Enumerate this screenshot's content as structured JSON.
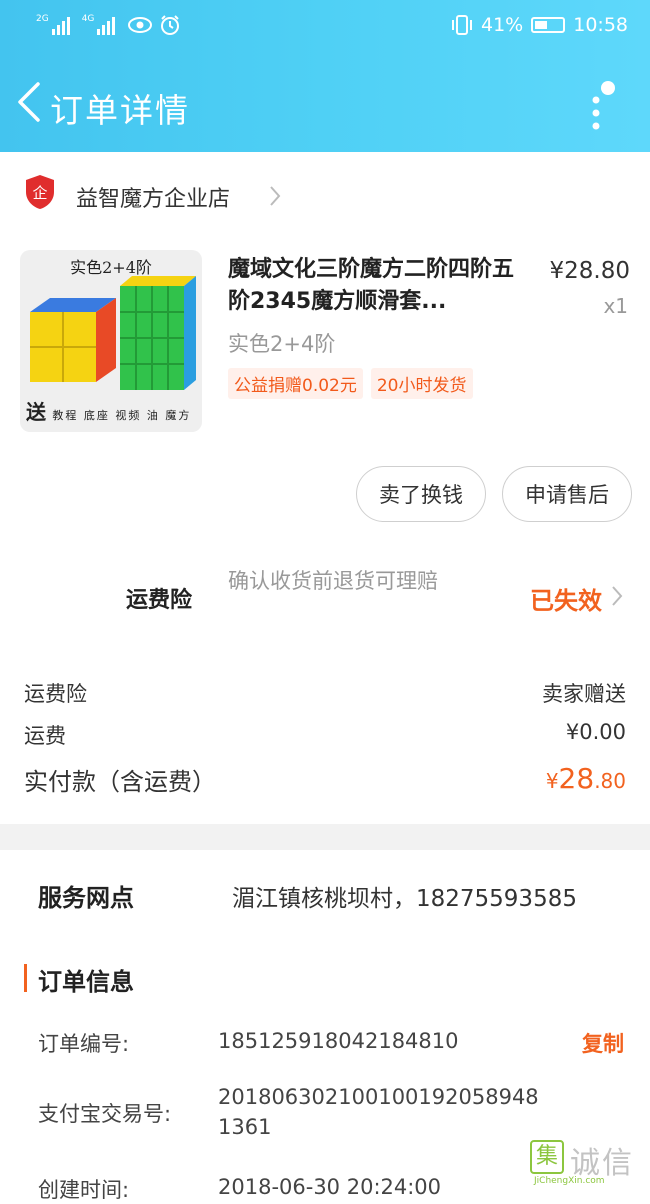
{
  "status_bar": {
    "signal1_label": "2G",
    "signal2_label": "4G",
    "battery_percent": "41%",
    "time": "10:58"
  },
  "nav": {
    "title": "订单详情"
  },
  "shop": {
    "name": "益智魔方企业店"
  },
  "product": {
    "image_top_text": "实色2+4阶",
    "image_bottom_big": "送",
    "image_bottom_small": "教程 底座 视频 油 魔方书",
    "title": "魔域文化三阶魔方二阶四阶五阶2345魔方顺滑套...",
    "price": "¥28.80",
    "qty": "x1",
    "sku": "实色2+4阶",
    "tags": [
      "公益捐赠0.02元",
      "20小时发货"
    ]
  },
  "actions": {
    "sell_label": "卖了换钱",
    "after_sale_label": "申请售后"
  },
  "insurance": {
    "label": "运费险",
    "desc": "确认收货前退货可理赔",
    "status": "已失效"
  },
  "fees": {
    "insurance_label": "运费险",
    "insurance_value": "卖家赠送",
    "shipping_label": "运费",
    "shipping_value": "¥0.00",
    "paid_label": "实付款（含运费）",
    "paid_yen": "¥",
    "paid_int": "28",
    "paid_dec": ".80"
  },
  "service": {
    "label": "服务网点",
    "value": "湄江镇核桃坝村，18275593585"
  },
  "order_info": {
    "title": "订单信息",
    "order_no_label": "订单编号:",
    "order_no": "185125918042184810",
    "copy_label": "复制",
    "alipay_label": "支付宝交易号:",
    "alipay_no": "20180630210010019205894813 61",
    "alipay_line1": "201806302100100192058948",
    "alipay_line2": "1361",
    "created_label": "创建时间:",
    "created_value": "2018-06-30 20:24:00"
  },
  "watermark": {
    "box_char": "集",
    "cn_text": "诚信",
    "en_text": "JiChengXin.com"
  },
  "colors": {
    "header_start": "#43c4ef",
    "header_end": "#5ed8fb",
    "accent_orange": "#f2621f"
  }
}
